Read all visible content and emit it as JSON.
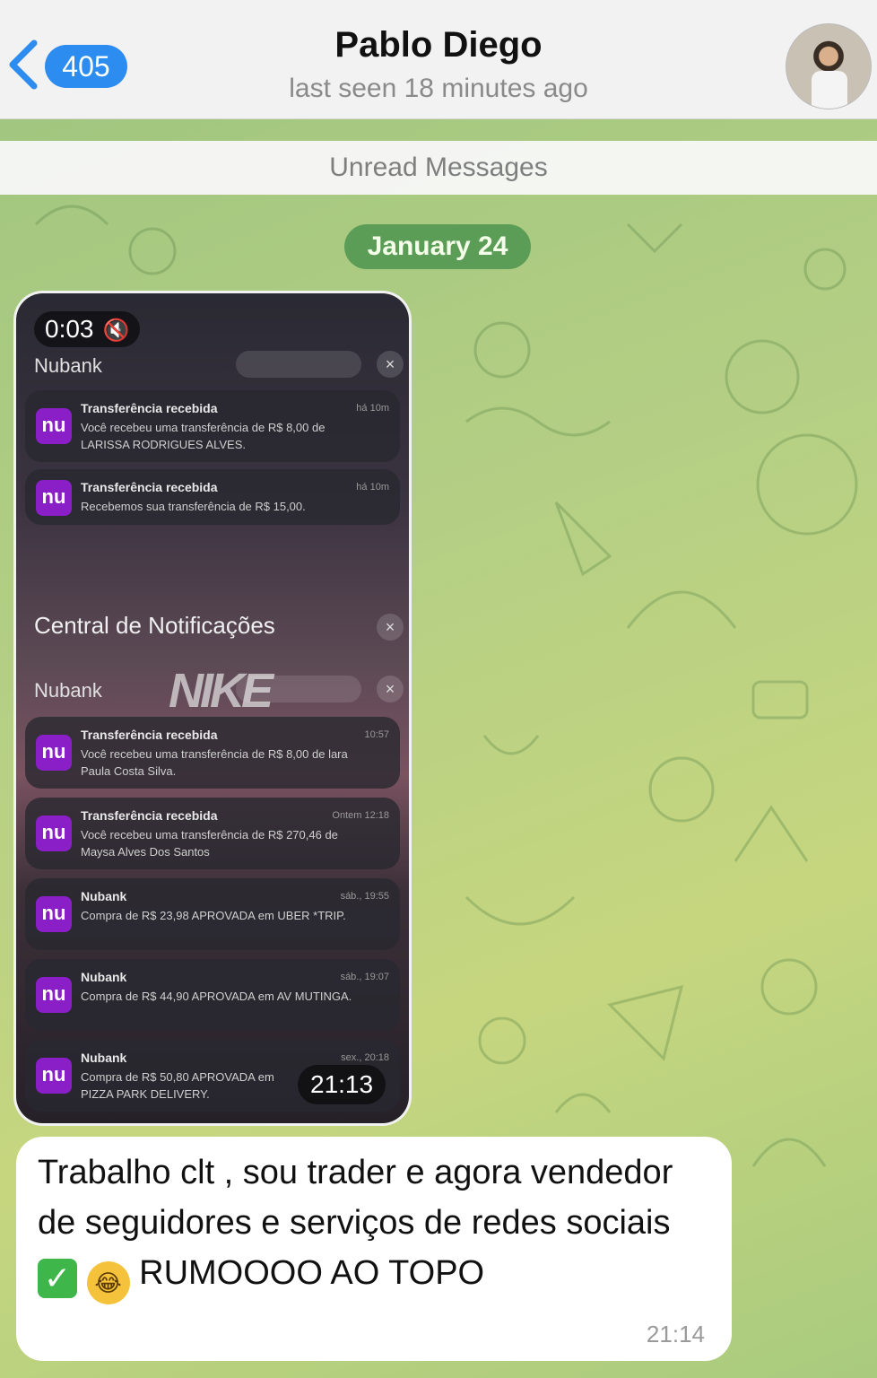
{
  "header": {
    "unread_count": "405",
    "contact_name": "Pablo Diego",
    "status": "last seen 18 minutes ago"
  },
  "unread_label": "Unread Messages",
  "date_label": "January 24",
  "video": {
    "duration": "0:03",
    "muted": true,
    "timestamp": "21:13",
    "screen": {
      "app_name": "Nubank",
      "section_title": "Central de Notificações",
      "group1": [
        {
          "title": "Transferência recebida",
          "body": "Você recebeu uma transferência de R$ 8,00 de LARISSA RODRIGUES ALVES.",
          "time": "há 10m"
        },
        {
          "title": "Transferência recebida",
          "body": "Recebemos sua transferência de R$ 15,00.",
          "time": "há 10m"
        }
      ],
      "group2": [
        {
          "title": "Transferência recebida",
          "body": "Você recebeu uma transferência de R$ 8,00 de lara Paula Costa Silva.",
          "time": "10:57"
        },
        {
          "title": "Transferência recebida",
          "body": "Você recebeu uma transferência de R$ 270,46 de Maysa Alves Dos Santos",
          "time": "Ontem 12:18"
        },
        {
          "title": "Nubank",
          "body": "Compra de R$ 23,98 APROVADA em UBER *TRIP.",
          "time": "sáb., 19:55"
        },
        {
          "title": "Nubank",
          "body": "Compra de R$ 44,90 APROVADA em AV MUTINGA.",
          "time": "sáb., 19:07"
        },
        {
          "title": "Nubank",
          "body": "Compra de R$ 50,80 APROVADA em PIZZA PARK DELIVERY.",
          "time": "sex., 20:18"
        }
      ]
    }
  },
  "message": {
    "text_part1": "Trabalho clt , sou trader e agora vendedor de seguidores e serviços de redes sociais ",
    "text_part2": " RUMOOOO AO TOPO",
    "time": "21:14"
  },
  "icons": {
    "back": "chevron-left-icon",
    "check": "check-mark-icon",
    "laugh": "tears-of-joy-icon",
    "mute": "speaker-muted-icon"
  },
  "colors": {
    "accent": "#2d8cf0",
    "date_pill": "#5b9c56",
    "nubank": "#8a1fc8"
  }
}
